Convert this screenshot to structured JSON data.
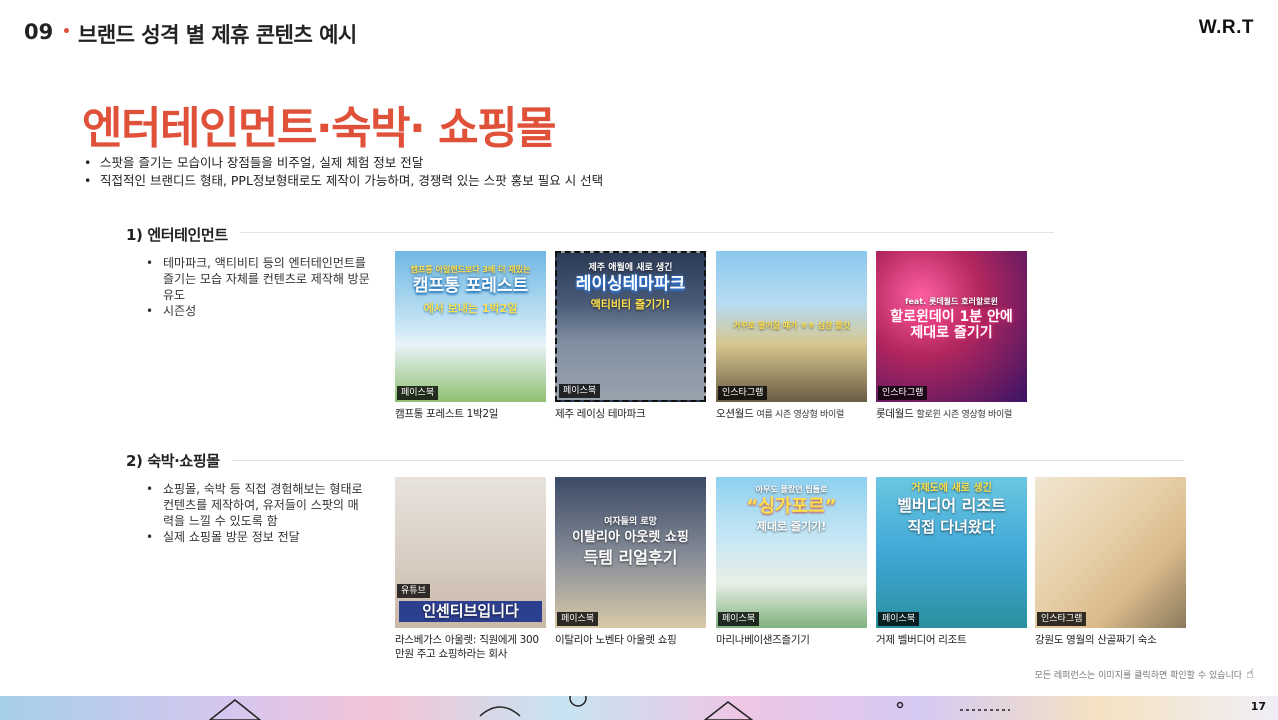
{
  "header": {
    "section_number": "09",
    "dot": "•",
    "title": "브랜드 성격 별 제휴 콘텐츠 예시",
    "logo": "W.R.T"
  },
  "main_title": "엔터테인먼트·숙박· 쇼핑몰",
  "bullets": [
    "스팟을 즐기는 모습이나 장점들을 비주얼, 실제 체험 정보 전달",
    "직접적인 브랜디드 형태, PPL정보형태로도 제작이 가능하며, 경쟁력 있는 스팟 홍보 필요 시 선택"
  ],
  "sections": [
    {
      "title": "1) 엔터테인먼트",
      "bullets": [
        "테마파크, 액티비티 등의 엔터테인먼트를 즐기는 모습 자체를 컨텐츠로 제작해 방문 유도",
        "시즌성"
      ],
      "cards": [
        {
          "platform": "페이스북",
          "caption": "캠프통 포레스트 1박2일",
          "caption_sub": "",
          "overlay_top": "캠프통 아일랜드보다 3배 더 재밌는",
          "overlay_main": "캠프통 포레스트",
          "overlay_bottom": "에서 보내는 1박2일",
          "colors": [
            "#6fb8e3",
            "#e9f3f9",
            "#8fbf70"
          ]
        },
        {
          "platform": "페이스북",
          "caption": "제주 레이싱 테마파크",
          "caption_sub": "",
          "overlay_top": "제주 애월에 새로 생긴",
          "overlay_main": "레이싱테마파크",
          "overlay_bottom": "액티비티 즐기기!",
          "colors": [
            "#2b3a55",
            "#7f8ea0",
            "#9aa3ad"
          ]
        },
        {
          "platform": "인스타그램",
          "caption": "오션월드",
          "caption_sub": "여름 시즌 영상형 바이럴",
          "overlay_top": "",
          "overlay_main": "",
          "overlay_bottom": "거꾸로 떨어질 때가 ㅎㅎ 심장 쫄깃",
          "colors": [
            "#8cc8ee",
            "#d6c68f",
            "#6a5c44"
          ]
        },
        {
          "platform": "인스타그램",
          "caption": "롯데월드",
          "caption_sub": "할로윈 시즌 영상형 바이럴",
          "overlay_top": "feat. 롯데월드 호러할로윈",
          "overlay_main": "할로윈데이 1분 안에 제대로 즐기기",
          "overlay_bottom": "",
          "colors": [
            "#3a1464",
            "#b2265e",
            "#ff5fa2"
          ]
        }
      ]
    },
    {
      "title": "2) 숙박·쇼핑몰",
      "bullets": [
        "쇼핑몰, 숙박 등 직접 경험해보는 형태로 컨텐츠를 제작하여, 유저들이 스팟의 매력을 느낄 수 있도록 함",
        "실제 쇼핑몰 방문 정보 전달"
      ],
      "cards": [
        {
          "platform": "유튜브",
          "caption": "라스베가스 아울렛: 직원에게 300만원 주고 쇼핑하라는 회사",
          "caption_sub": "",
          "overlay_top": "",
          "overlay_main": "",
          "overlay_bottom": "인센티브입니다",
          "colors": [
            "#e8e3dd",
            "#c9b9a8",
            "#2d3f8f"
          ]
        },
        {
          "platform": "페이스북",
          "caption": "이탈리아 노벤타 아울렛 쇼핑",
          "caption_sub": "",
          "overlay_top": "여자들의 로망",
          "overlay_main": "이탈리아 아웃렛 쇼핑",
          "overlay_bottom": "득템 리얼후기",
          "colors": [
            "#3b4a66",
            "#8a8f99",
            "#d9c9a8"
          ]
        },
        {
          "platform": "페이스북",
          "caption": "마리나베이샌즈즐기기",
          "caption_sub": "",
          "overlay_top": "아무도 몰랐던 팁들로",
          "overlay_main": "“싱가포르”",
          "overlay_bottom": "제대로 즐기기!",
          "colors": [
            "#8ed0f0",
            "#e9efe7",
            "#7fb27f"
          ]
        },
        {
          "platform": "페이스북",
          "caption": "거제 벨버디어 리조트",
          "caption_sub": "",
          "overlay_top": "거제도에 새로 생긴",
          "overlay_main": "벨버디어 리조트",
          "overlay_bottom": "직접 다녀왔다",
          "colors": [
            "#3fa8d8",
            "#6cc7e0",
            "#2a8f9e"
          ]
        },
        {
          "platform": "인스타그램",
          "caption": "강원도 영월의 산골짜기 숙소",
          "caption_sub": "",
          "overlay_top": "",
          "overlay_main": "",
          "overlay_bottom": "",
          "colors": [
            "#f1e6d2",
            "#d9b98a",
            "#8a7a5c"
          ]
        }
      ]
    }
  ],
  "footnote": "모든 레퍼런스는 이미지를 클릭하면 확인할 수 있습니다",
  "page_number": "17"
}
